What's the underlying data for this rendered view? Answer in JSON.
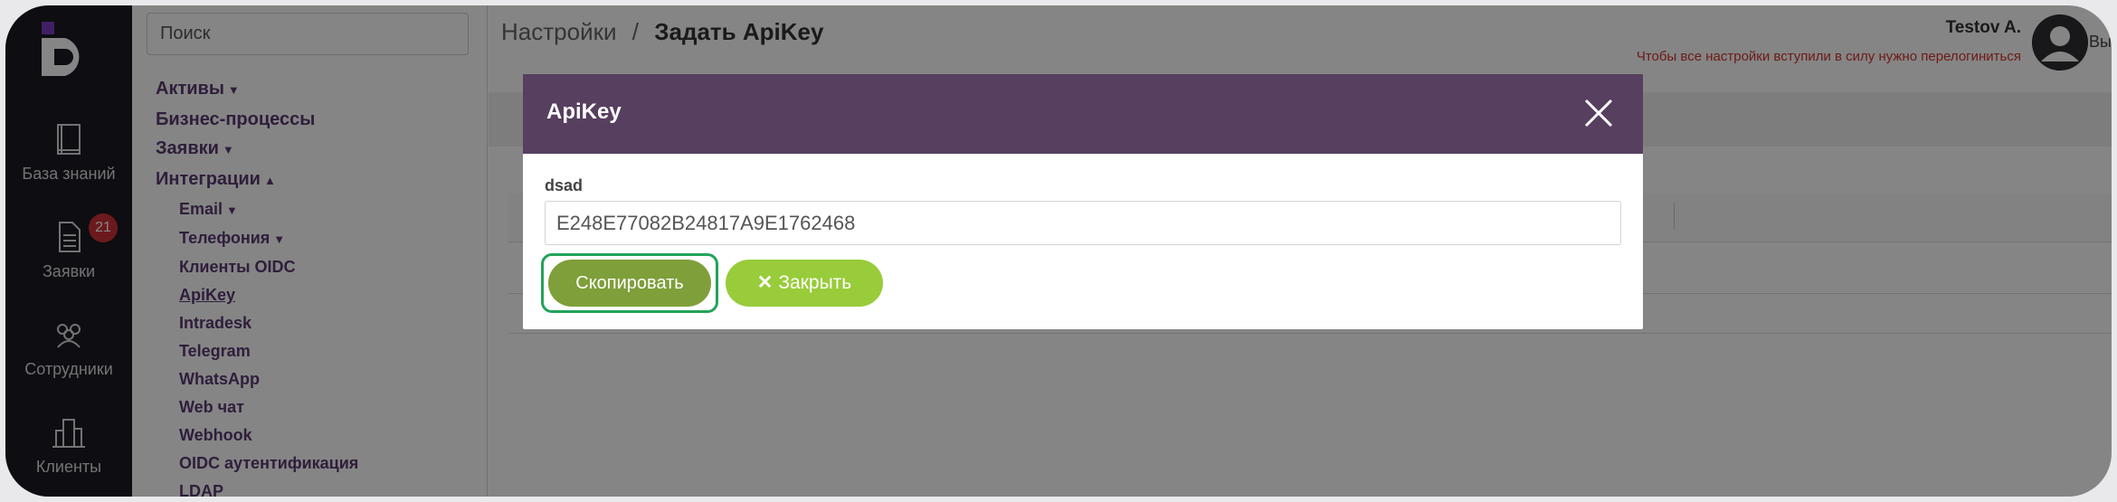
{
  "rail": {
    "items": [
      {
        "label": "База знаний",
        "icon": "book-icon"
      },
      {
        "label": "Заявки",
        "icon": "document-icon",
        "badge": "21"
      },
      {
        "label": "Сотрудники",
        "icon": "people-icon"
      },
      {
        "label": "Клиенты",
        "icon": "buildings-icon"
      }
    ]
  },
  "sidebar": {
    "search_placeholder": "Поиск",
    "menu": [
      {
        "label": "Активы"
      },
      {
        "label": "Бизнес-процессы"
      },
      {
        "label": "Заявки"
      },
      {
        "label": "Интеграции"
      }
    ],
    "submenu": [
      "Email",
      "Телефония",
      "Клиенты OIDC",
      "ApiKey",
      "Intradesk",
      "Telegram",
      "WhatsApp",
      "Web чат",
      "Webhook",
      "OIDC аутентификация",
      "LDAP"
    ]
  },
  "header": {
    "breadcrumb_root": "Настройки",
    "breadcrumb_sep": "/",
    "breadcrumb_current": "Задать ApiKey",
    "user_name": "Testov A.",
    "relogin_notice": "Чтобы все настройки вступили в силу нужно перелогиниться",
    "logout_partial": "Вы"
  },
  "modal": {
    "title": "ApiKey",
    "field_label": "dsad",
    "field_value": "E248E77082B24817A9E1762468",
    "copy_button": "Скопировать",
    "close_button": "Закрыть"
  },
  "colors": {
    "modal_header": "#573f5f",
    "copy_button": "#7e9f3a",
    "close_button": "#98cc3a",
    "focus_ring": "#21a35a",
    "brand_accent": "#6b3fa0"
  }
}
